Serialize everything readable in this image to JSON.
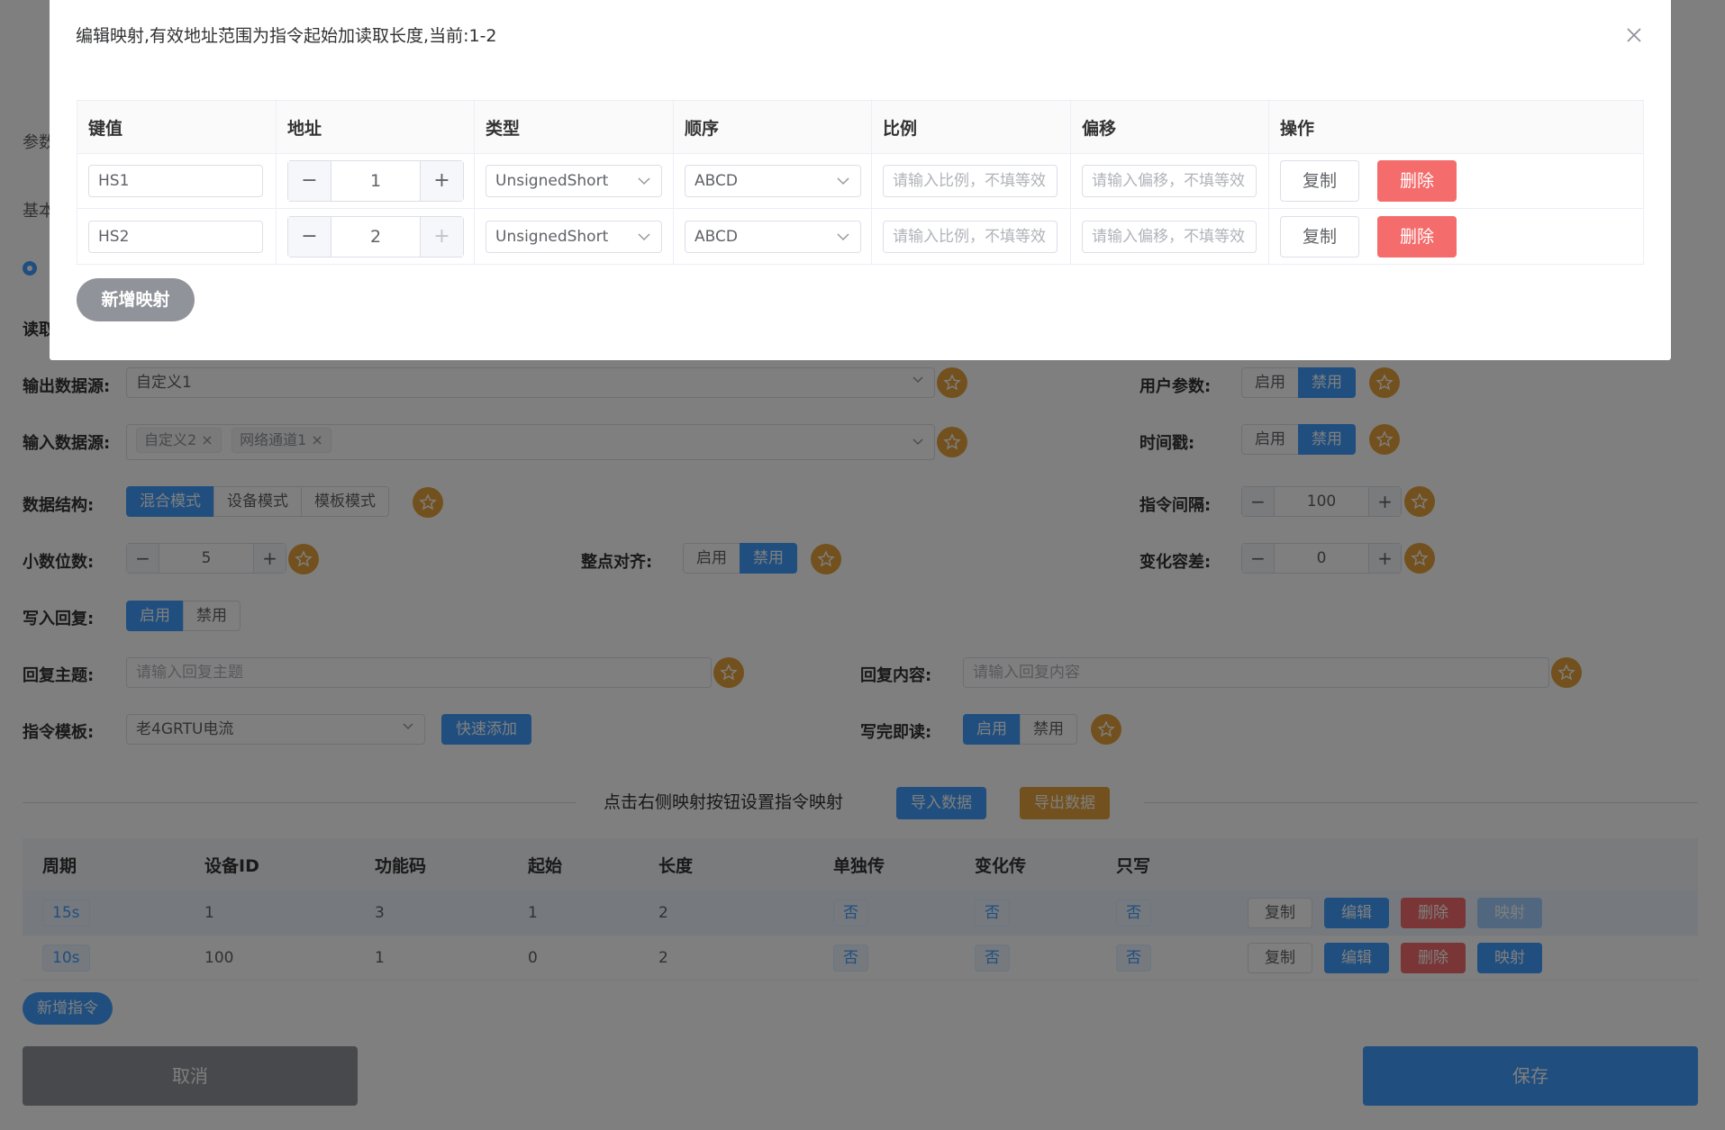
{
  "background": {
    "partial_labels": {
      "params": "参数",
      "basic": "基本",
      "read": "读取"
    },
    "output_source": {
      "label": "输出数据源:",
      "value": "自定义1"
    },
    "input_source": {
      "label": "输入数据源:",
      "tags": [
        "自定义2",
        "网络通道1"
      ]
    },
    "data_structure": {
      "label": "数据结构:",
      "options": [
        "混合模式",
        "设备模式",
        "模板模式"
      ],
      "selected": "混合模式"
    },
    "decimal_places": {
      "label": "小数位数:",
      "value": "5"
    },
    "whole_point_align": {
      "label": "整点对齐:",
      "options": [
        "启用",
        "禁用"
      ],
      "selected": "禁用"
    },
    "write_reply": {
      "label": "写入回复:",
      "options": [
        "启用",
        "禁用"
      ],
      "selected": "启用"
    },
    "reply_topic": {
      "label": "回复主题:",
      "placeholder": "请输入回复主题"
    },
    "reply_content": {
      "label": "回复内容:",
      "placeholder": "请输入回复内容"
    },
    "cmd_template": {
      "label": "指令模板:",
      "value": "老4GRTU电流",
      "quick_add": "快速添加"
    },
    "read_after_write": {
      "label": "写完即读:",
      "options": [
        "启用",
        "禁用"
      ],
      "selected": "启用"
    },
    "user_params": {
      "label": "用户参数:",
      "options": [
        "启用",
        "禁用"
      ],
      "selected": "禁用"
    },
    "timestamp": {
      "label": "时间戳:",
      "options": [
        "启用",
        "禁用"
      ],
      "selected": "禁用"
    },
    "cmd_interval": {
      "label": "指令间隔:",
      "value": "100"
    },
    "change_tolerance": {
      "label": "变化容差:",
      "value": "0"
    },
    "divider_text": "点击右侧映射按钮设置指令映射",
    "import_btn": "导入数据",
    "export_btn": "导出数据",
    "table": {
      "headers": [
        "周期",
        "设备ID",
        "功能码",
        "起始",
        "长度",
        "单独传",
        "变化传",
        "只写"
      ],
      "rows": [
        {
          "period": "15s",
          "device_id": "1",
          "func": "3",
          "start": "1",
          "length": "2",
          "single": "否",
          "change": "否",
          "write_only": "否"
        },
        {
          "period": "10s",
          "device_id": "100",
          "func": "1",
          "start": "0",
          "length": "2",
          "single": "否",
          "change": "否",
          "write_only": "否"
        }
      ],
      "actions": {
        "copy": "复制",
        "edit": "编辑",
        "delete": "删除",
        "map": "映射"
      }
    },
    "add_cmd": "新增指令",
    "cancel": "取消",
    "save": "保存"
  },
  "dialog": {
    "title": "编辑映射,有效地址范围为指令起始加读取长度,当前:1-2",
    "headers": [
      "键值",
      "地址",
      "类型",
      "顺序",
      "比例",
      "偏移",
      "操作"
    ],
    "rows": [
      {
        "key": "HS1",
        "address": "1",
        "type": "UnsignedShort",
        "order": "ABCD",
        "scale_ph": "请输入比例，不填等效",
        "offset_ph": "请输入偏移，不填等效"
      },
      {
        "key": "HS2",
        "address": "2",
        "type": "UnsignedShort",
        "order": "ABCD",
        "scale_ph": "请输入比例，不填等效",
        "offset_ph": "请输入偏移，不填等效"
      }
    ],
    "copy_btn": "复制",
    "delete_btn": "删除",
    "add_mapping": "新增映射"
  },
  "colors": {
    "primary": "#409eff",
    "danger": "#f56c6c",
    "warning": "#e6a23c",
    "info": "#909399"
  }
}
